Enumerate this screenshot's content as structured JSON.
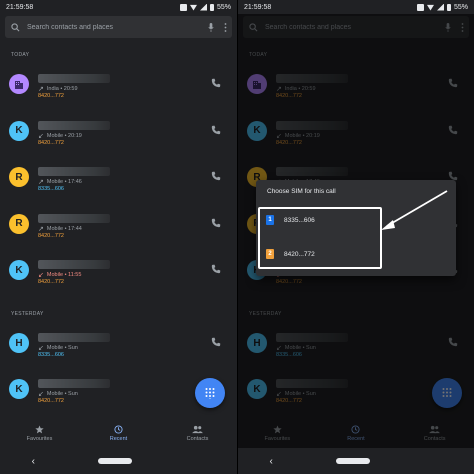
{
  "status": {
    "time": "21:59:58",
    "battery": "55%"
  },
  "search": {
    "placeholder": "Search contacts and places"
  },
  "sections": {
    "today": "TODAY",
    "yesterday": "YESTERDAY"
  },
  "calls": [
    {
      "avatar": "",
      "avatar_color": "#b388ff",
      "type": "outgoing",
      "label": "India • 20:59",
      "sim": "8420...772",
      "sim_color": "#f0a03c"
    },
    {
      "avatar": "K",
      "avatar_color": "#4fc3f7",
      "type": "incoming",
      "label": "Mobile • 20:19",
      "sim": "8420...772",
      "sim_color": "#f0a03c"
    },
    {
      "avatar": "R",
      "avatar_color": "#fbc02d",
      "type": "outgoing",
      "label": "Mobile • 17:46",
      "sim": "8335...606",
      "sim_color": "#4fc3f7"
    },
    {
      "avatar": "R",
      "avatar_color": "#fbc02d",
      "type": "outgoing",
      "label": "Mobile • 17:44",
      "sim": "8420...772",
      "sim_color": "#f0a03c"
    },
    {
      "avatar": "K",
      "avatar_color": "#4fc3f7",
      "type": "missed",
      "label": "Mobile • 11:55",
      "sim": "8420...772",
      "sim_color": "#f0a03c"
    }
  ],
  "yesterday_calls": [
    {
      "avatar": "H",
      "avatar_color": "#4fc3f7",
      "type": "incoming",
      "label": "Mobile • Sun",
      "sim": "8335...606",
      "sim_color": "#4fc3f7"
    },
    {
      "avatar": "K",
      "avatar_color": "#4fc3f7",
      "type": "incoming",
      "label": "Mobile • Sun",
      "sim": "8420...772",
      "sim_color": "#f0a03c"
    }
  ],
  "nav": {
    "favourites": "Favourites",
    "recent": "Recent",
    "contacts": "Contacts"
  },
  "dialog": {
    "title": "Choose SIM for this call",
    "sim1_slot": "1",
    "sim1_number": "8335...606",
    "sim1_color": "#1a73e8",
    "sim2_slot": "2",
    "sim2_number": "8420...772",
    "sim2_color": "#f0a03c"
  }
}
